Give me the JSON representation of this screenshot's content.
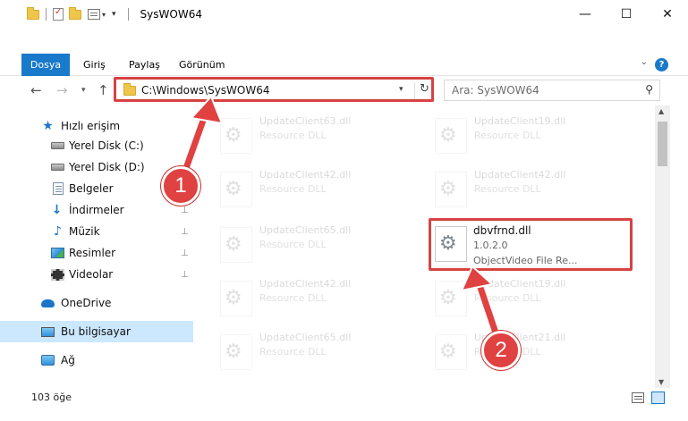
{
  "window": {
    "title": "SysWOW64",
    "controls": {
      "minimize": "—",
      "maximize": "☐",
      "close": "✕"
    }
  },
  "quick_access_toolbar": {
    "dropdown": "▾"
  },
  "ribbon": {
    "tabs": [
      {
        "label": "Dosya",
        "active": true
      },
      {
        "label": "Giriş"
      },
      {
        "label": "Paylaş"
      },
      {
        "label": "Görünüm"
      }
    ],
    "collapse_glyph": "⌄",
    "help_glyph": "?"
  },
  "navigation": {
    "back": "←",
    "forward": "→",
    "recent": "▾",
    "up": "↑",
    "address": "C:\\Windows\\SysWOW64",
    "address_dropdown": "▾",
    "refresh": "↻",
    "search_placeholder": "Ara: SysWOW64",
    "search_icon": "⚲"
  },
  "sidebar": {
    "items": [
      {
        "label": "Hızlı erişim",
        "icon": "star-icon"
      },
      {
        "label": "Yerel Disk (C:)",
        "icon": "disk-icon",
        "pinned": true
      },
      {
        "label": "Yerel Disk (D:)",
        "icon": "disk-icon",
        "pinned": true
      },
      {
        "label": "Belgeler",
        "icon": "documents-icon",
        "pinned": true
      },
      {
        "label": "İndirmeler",
        "icon": "downloads-icon",
        "pinned": true
      },
      {
        "label": "Müzik",
        "icon": "music-icon",
        "pinned": true
      },
      {
        "label": "Resimler",
        "icon": "pictures-icon",
        "pinned": true
      },
      {
        "label": "Videolar",
        "icon": "videos-icon",
        "pinned": true
      },
      {
        "label": "OneDrive",
        "icon": "onedrive-icon"
      },
      {
        "label": "Bu bilgisayar",
        "icon": "this-pc-icon",
        "selected": true
      },
      {
        "label": "Ağ",
        "icon": "network-icon"
      }
    ],
    "pin_glyph": "📌"
  },
  "files": {
    "left_column": [
      {
        "name": "UpdateClient63.dll",
        "description": "Resource DLL"
      },
      {
        "name": "UpdateClient42.dll",
        "description": "Resource DLL"
      },
      {
        "name": "UpdateClient65.dll",
        "description": "Resource DLL"
      },
      {
        "name": "UpdateClient42.dll",
        "description": "Resource DLL"
      },
      {
        "name": "UpdateClient65.dll",
        "description": "Resource DLL"
      }
    ],
    "right_column": [
      {
        "name": "UpdateClient19.dll",
        "description": "Resource DLL"
      },
      {
        "name": "UpdateClient42.dll",
        "description": "Resource DLL"
      },
      {
        "name": "UpdateClient19.dll",
        "description": "Resource DLL"
      },
      {
        "name": "UpdateClient21.dll",
        "description": "Resource DLL"
      }
    ],
    "highlighted": {
      "name": "dbvfrnd.dll",
      "version": "1.0.2.0",
      "description": "ObjectVideo File Re..."
    }
  },
  "status": {
    "item_count": "103 öğe"
  },
  "annotations": {
    "badge_1": "1",
    "badge_2": "2",
    "color": "#d74242"
  },
  "colors": {
    "accent": "#1979ca",
    "selected_bg": "#cce8ff",
    "highlight_red": "#d74242"
  }
}
